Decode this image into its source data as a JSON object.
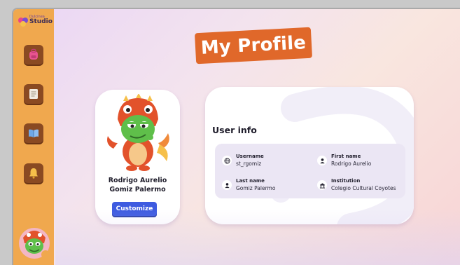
{
  "brand": {
    "small_text": "Dulcinea",
    "name": "Studio"
  },
  "sidebar": {
    "items": [
      {
        "name": "backpack",
        "icon": "backpack-icon"
      },
      {
        "name": "notes",
        "icon": "document-icon"
      },
      {
        "name": "library",
        "icon": "book-icon"
      },
      {
        "name": "notifications",
        "icon": "bell-icon"
      }
    ]
  },
  "page": {
    "title": "My Profile"
  },
  "profile": {
    "full_name": "Rodrigo Aurelio Gomiz Palermo",
    "customize_label": "Customize",
    "avatar": "dragon-avatar"
  },
  "user_info": {
    "title": "User info",
    "fields": [
      {
        "label": "Username",
        "value": "st_rgomiz",
        "icon": "globe-icon"
      },
      {
        "label": "First name",
        "value": "Rodrigo Aurelio",
        "icon": "person-icon"
      },
      {
        "label": "Last name",
        "value": "Gomiz Palermo",
        "icon": "person-icon"
      },
      {
        "label": "Institution",
        "value": "Colegio Cultural Coyotes",
        "icon": "school-icon"
      }
    ]
  },
  "colors": {
    "sidebar": "#f0a84e",
    "nav_button": "#8a4a22",
    "title_banner": "#e0682a",
    "primary_button": "#3e5be0",
    "info_panel": "#ebe6f4"
  }
}
